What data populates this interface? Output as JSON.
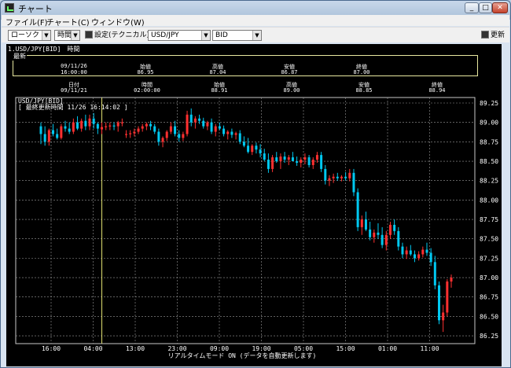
{
  "window": {
    "title": "チャート"
  },
  "menu": [
    "ファイル(F)",
    "チャート(C)",
    "ウィンドウ(W)"
  ],
  "toolbar": {
    "chart_type": "ローソク",
    "period": "時間",
    "settings_label": "設定(テクニカル)",
    "symbol": "USD/JPY",
    "side": "BID",
    "refresh_label": "更新"
  },
  "panel": {
    "title": "1.USD/JPY[BID]　時間"
  },
  "latest": {
    "label": "最新",
    "date": "09/11/26",
    "time": "16:00:00",
    "open_label": "始値",
    "open": "86.95",
    "high_label": "高値",
    "high": "87.04",
    "low_label": "安値",
    "low": "86.87",
    "close_label": "終値",
    "close": "87.00"
  },
  "cursor": {
    "date_label": "日付",
    "date": "09/11/21",
    "time_label": "時間",
    "time": "02:00:00",
    "open_label": "始値",
    "open": "88.91",
    "high_label": "高値",
    "high": "89.00",
    "low_label": "安値",
    "low": "88.85",
    "close_label": "終値",
    "close": "88.94"
  },
  "chart_header": {
    "series_label": "USD/JPY[BID]",
    "last_update": "[ 最終更新時間 11/26 16:14:02 ]"
  },
  "footer_text": "リアルタイムモード ON (データを自動更新します)",
  "colors": {
    "up": "#ff3030",
    "down": "#00c8f0",
    "grid": "#9a9a9a",
    "cursor": "#e0e070"
  },
  "chart_data": {
    "type": "candlestick",
    "ylim": [
      86.2,
      89.25
    ],
    "y_ticks": [
      "89.25",
      "89.00",
      "88.75",
      "88.50",
      "88.25",
      "88.00",
      "87.75",
      "87.50",
      "87.25",
      "87.00",
      "86.75",
      "86.50",
      "86.25"
    ],
    "x_ticks": [
      "16:00",
      "04:00",
      "13:00",
      "23:00",
      "09:00",
      "19:00",
      "05:00",
      "15:00",
      "01:00",
      "11:00"
    ],
    "cursor_index": 15,
    "ohlc": [
      [
        88.95,
        89.0,
        88.72,
        88.85
      ],
      [
        88.85,
        88.95,
        88.7,
        88.75
      ],
      [
        88.75,
        88.92,
        88.7,
        88.9
      ],
      [
        88.9,
        88.98,
        88.82,
        88.85
      ],
      [
        88.85,
        88.92,
        88.78,
        88.8
      ],
      [
        88.8,
        88.98,
        88.78,
        88.95
      ],
      [
        88.95,
        89.02,
        88.88,
        88.92
      ],
      [
        88.92,
        89.0,
        88.85,
        88.88
      ],
      [
        88.88,
        89.05,
        88.85,
        89.0
      ],
      [
        89.0,
        89.08,
        88.9,
        88.92
      ],
      [
        88.92,
        89.05,
        88.88,
        89.02
      ],
      [
        89.02,
        89.1,
        88.9,
        88.95
      ],
      [
        88.95,
        89.1,
        88.9,
        89.05
      ],
      [
        89.05,
        89.12,
        88.92,
        88.98
      ],
      [
        88.98,
        89.0,
        88.85,
        88.92
      ],
      [
        88.91,
        89.0,
        88.85,
        88.94
      ],
      [
        88.94,
        89.0,
        88.9,
        88.95
      ],
      [
        88.95,
        89.0,
        88.9,
        88.96
      ],
      [
        88.96,
        89.0,
        88.9,
        88.95
      ],
      [
        88.95,
        89.02,
        88.88,
        89.0
      ],
      [
        89.0,
        89.05,
        88.95,
        89.0
      ],
      [
        88.85,
        88.9,
        88.8,
        88.85
      ],
      [
        88.85,
        88.9,
        88.8,
        88.86
      ],
      [
        88.86,
        88.92,
        88.82,
        88.88
      ],
      [
        88.88,
        88.95,
        88.85,
        88.92
      ],
      [
        88.92,
        88.98,
        88.88,
        88.95
      ],
      [
        88.95,
        89.0,
        88.9,
        88.98
      ],
      [
        88.98,
        89.02,
        88.9,
        88.95
      ],
      [
        88.95,
        88.98,
        88.85,
        88.88
      ],
      [
        88.88,
        88.92,
        88.7,
        88.75
      ],
      [
        88.75,
        88.82,
        88.68,
        88.8
      ],
      [
        88.8,
        88.9,
        88.76,
        88.88
      ],
      [
        88.88,
        89.0,
        88.85,
        88.95
      ],
      [
        88.95,
        89.02,
        88.82,
        88.85
      ],
      [
        88.85,
        88.9,
        88.75,
        88.8
      ],
      [
        88.8,
        88.88,
        88.76,
        88.85
      ],
      [
        88.85,
        89.15,
        88.82,
        89.1
      ],
      [
        89.1,
        89.18,
        88.95,
        89.0
      ],
      [
        89.0,
        89.08,
        88.92,
        89.05
      ],
      [
        89.05,
        89.1,
        88.98,
        89.02
      ],
      [
        89.02,
        89.06,
        88.92,
        88.95
      ],
      [
        88.95,
        89.02,
        88.9,
        89.0
      ],
      [
        89.0,
        89.05,
        88.85,
        88.88
      ],
      [
        88.88,
        88.98,
        88.82,
        88.95
      ],
      [
        88.95,
        89.0,
        88.9,
        88.92
      ],
      [
        88.92,
        88.96,
        88.82,
        88.85
      ],
      [
        88.85,
        88.9,
        88.78,
        88.88
      ],
      [
        88.88,
        88.92,
        88.8,
        88.84
      ],
      [
        88.84,
        88.88,
        88.78,
        88.86
      ],
      [
        88.86,
        88.9,
        88.72,
        88.75
      ],
      [
        88.75,
        88.82,
        88.68,
        88.7
      ],
      [
        88.7,
        88.8,
        88.6,
        88.62
      ],
      [
        88.62,
        88.72,
        88.58,
        88.7
      ],
      [
        88.7,
        88.74,
        88.6,
        88.65
      ],
      [
        88.65,
        88.72,
        88.55,
        88.6
      ],
      [
        88.6,
        88.66,
        88.5,
        88.52
      ],
      [
        88.52,
        88.6,
        88.35,
        88.4
      ],
      [
        88.4,
        88.58,
        88.36,
        88.55
      ],
      [
        88.55,
        88.62,
        88.48,
        88.5
      ],
      [
        88.5,
        88.6,
        88.4,
        88.56
      ],
      [
        88.56,
        88.62,
        88.48,
        88.52
      ],
      [
        88.52,
        88.58,
        88.45,
        88.55
      ],
      [
        88.55,
        88.62,
        88.5,
        88.5
      ],
      [
        88.5,
        88.56,
        88.44,
        88.48
      ],
      [
        88.48,
        88.55,
        88.42,
        88.52
      ],
      [
        88.52,
        88.6,
        88.46,
        88.55
      ],
      [
        88.55,
        88.58,
        88.42,
        88.45
      ],
      [
        88.45,
        88.55,
        88.4,
        88.52
      ],
      [
        88.52,
        88.62,
        88.48,
        88.58
      ],
      [
        88.58,
        88.62,
        88.36,
        88.4
      ],
      [
        88.4,
        88.45,
        88.2,
        88.25
      ],
      [
        88.25,
        88.32,
        88.18,
        88.28
      ],
      [
        88.28,
        88.34,
        88.22,
        88.3
      ],
      [
        88.3,
        88.35,
        88.25,
        88.28
      ],
      [
        88.28,
        88.32,
        88.24,
        88.3
      ],
      [
        88.3,
        88.36,
        88.25,
        88.28
      ],
      [
        88.28,
        88.4,
        88.24,
        88.35
      ],
      [
        88.35,
        88.4,
        88.05,
        88.1
      ],
      [
        88.1,
        88.15,
        87.6,
        87.65
      ],
      [
        87.65,
        87.8,
        87.55,
        87.75
      ],
      [
        87.75,
        87.85,
        87.6,
        87.62
      ],
      [
        87.62,
        87.72,
        87.48,
        87.52
      ],
      [
        87.52,
        87.62,
        87.45,
        87.58
      ],
      [
        87.58,
        87.7,
        87.5,
        87.55
      ],
      [
        87.55,
        87.65,
        87.38,
        87.42
      ],
      [
        87.42,
        87.6,
        87.35,
        87.55
      ],
      [
        87.55,
        87.72,
        87.5,
        87.68
      ],
      [
        87.68,
        87.75,
        87.55,
        87.6
      ],
      [
        87.6,
        87.65,
        87.35,
        87.4
      ],
      [
        87.4,
        87.45,
        87.25,
        87.3
      ],
      [
        87.3,
        87.4,
        87.24,
        87.35
      ],
      [
        87.35,
        87.42,
        87.28,
        87.3
      ],
      [
        87.3,
        87.35,
        87.2,
        87.25
      ],
      [
        87.25,
        87.34,
        87.22,
        87.3
      ],
      [
        87.3,
        87.4,
        87.26,
        87.36
      ],
      [
        87.36,
        87.45,
        87.28,
        87.32
      ],
      [
        87.32,
        87.38,
        87.15,
        87.2
      ],
      [
        87.2,
        87.28,
        86.85,
        86.9
      ],
      [
        86.9,
        86.95,
        86.4,
        86.45
      ],
      [
        86.45,
        86.65,
        86.3,
        86.55
      ],
      [
        86.55,
        86.98,
        86.5,
        86.95
      ],
      [
        86.95,
        87.04,
        86.87,
        87.0
      ]
    ]
  }
}
